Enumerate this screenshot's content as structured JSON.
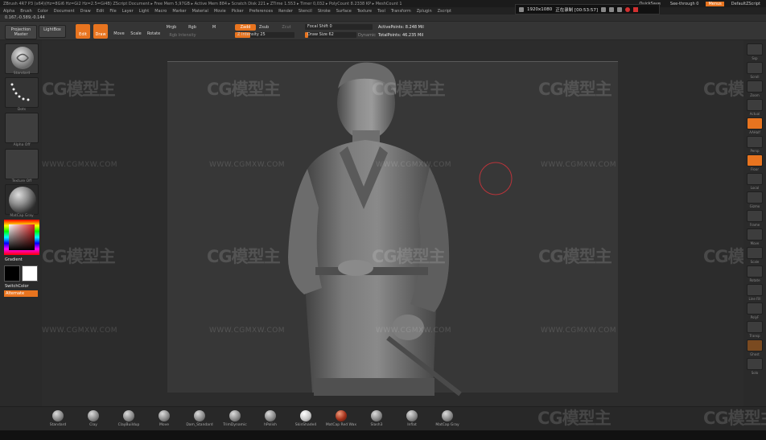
{
  "window": {
    "title": "ZBrush 4R7 P3 (x64)(Hz=8Gi6 Hz=Gi2 Hz=2.5=Gi4B)   ZScript Document   ▸ Free Mem 5,97GB ▸ Active Mem 884 ▸ Scratch Disk 221 ▸ ZTime 1.553 ▸ Timer 0,032 ▸ PolyCount 8.2338 KP ▸ MeshCount 1",
    "quicksave": "QuickSave",
    "see_through": "See-through  0",
    "menus_label": "Menus",
    "default_zscript": "DefaultZScript"
  },
  "menubar": [
    "Alpha",
    "Brush",
    "Color",
    "Document",
    "Draw",
    "Edit",
    "File",
    "Layer",
    "Light",
    "Macro",
    "Marker",
    "Material",
    "Movie",
    "Picker",
    "Preferences",
    "Render",
    "Stencil",
    "Stroke",
    "Surface",
    "Texture",
    "Tool",
    "Transform",
    "Zplugin",
    "Zscript"
  ],
  "recorder": {
    "resolution": "1920x1080",
    "status": "正在录制 [00:53:57]"
  },
  "coords": "0.167,-0.589,-0.144",
  "toolbar": {
    "projection_master": "Projection Master",
    "lightbox": "LightBox",
    "edit": "Edit",
    "draw": "Draw",
    "move": "Move",
    "scale": "Scale",
    "rotate": "Rotate",
    "mrgb": "Mrgb",
    "rgb": "Rgb",
    "m": "M",
    "rgb_intensity": "Rgb Intensity",
    "zadd": "Zadd",
    "zsub": "Zsub",
    "zcut": "Zcut",
    "z_intensity": "Z Intensity 25",
    "focal_shift": "Focal Shift 0",
    "draw_size": "Draw Size 62",
    "dynamic": "Dynamic",
    "active_points": "ActivePoints: 8.248 Mil",
    "total_points": "TotalPoints: 46.235 Mil",
    "z_intensity_value": 25,
    "z_intensity_max": 100,
    "draw_size_value": 62,
    "draw_size_max": 1000
  },
  "leftpanel": {
    "brush_label": "Standard",
    "stroke_label": "Dots",
    "alpha_label": "Alpha Off",
    "texture_label": "Texture Off",
    "material_label": "MatCap Gray",
    "gradient": "Gradient",
    "switchcolor": "SwitchColor",
    "alternate": "Alternate"
  },
  "rightshelf": {
    "labels": [
      "Ssp",
      "Scroll",
      "Zoom",
      "Actual",
      "AAHalf",
      "Persp",
      "Floor",
      "Local",
      "Gizmo",
      "Frame",
      "Move",
      "Scale",
      "Rotate",
      "Line Fill",
      "PolyF",
      "Transp",
      "Ghost",
      "Solo"
    ]
  },
  "brushes": [
    "Standard",
    "Clay",
    "ClayBuildup",
    "Move",
    "Dam_Standard",
    "TrimDynamic",
    "hPolish",
    "SkinShade4",
    "MatCap Red Wax",
    "Slash3",
    "Inflat",
    "MatCap Gray"
  ],
  "watermark": {
    "logo": "CG模型主",
    "url": "WWW.CGMXW.COM"
  },
  "colors": {
    "accent": "#e8741f",
    "background": "#2e2e2e",
    "viewport": "#373737",
    "brush_cursor": "#b8343a"
  }
}
